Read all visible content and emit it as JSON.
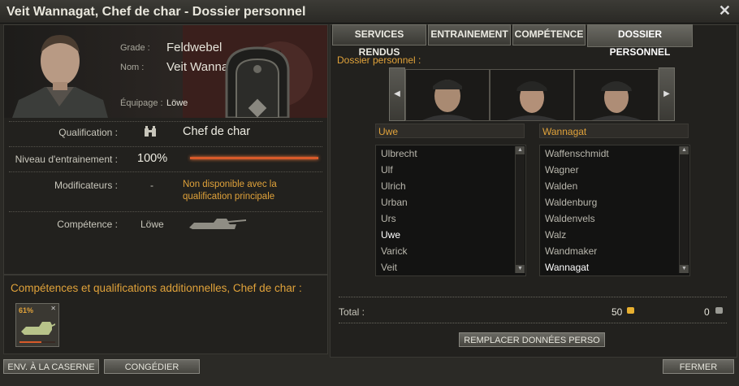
{
  "window": {
    "title": "Veit Wannagat, Chef de char - Dossier personnel",
    "close_label": "✕"
  },
  "profile": {
    "grade_label": "Grade :",
    "grade_value": "Feldwebel",
    "name_label": "Nom :",
    "name_value": "Veit Wannagat",
    "crew_label": "Équipage :",
    "crew_value": "Löwe"
  },
  "stats": {
    "qualification_label": "Qualification :",
    "qualification_value": "Chef de char",
    "training_label": "Niveau d'entrainement :",
    "training_value": "100%",
    "training_fraction": 1.0,
    "modifiers_label": "Modificateurs :",
    "modifiers_value": "-",
    "modifiers_note": "Non disponible avec la qualification principale",
    "skill_label": "Compétence :",
    "skill_value": "Löwe"
  },
  "additional": {
    "title": "Compétences et qualifications additionnelles, Chef de char :",
    "skill_percent": "61%",
    "skill_remove": "✕",
    "skill_fraction": 0.61
  },
  "tabs": [
    {
      "label": "SERVICES RENDUS"
    },
    {
      "label": "ENTRAINEMENT"
    },
    {
      "label": "COMPÉTENCE"
    },
    {
      "label": "DOSSIER PERSONNEL"
    }
  ],
  "dossier": {
    "section_label": "Dossier personnel :",
    "first_name_header": "Uwe",
    "last_name_header": "Wannagat",
    "first_names": [
      "Ulbrecht",
      "Ulf",
      "Ulrich",
      "Urban",
      "Urs",
      "Uwe",
      "Varick",
      "Veit"
    ],
    "first_selected_index": 5,
    "last_names": [
      "Waffenschmidt",
      "Wagner",
      "Walden",
      "Waldenburg",
      "Waldenvels",
      "Walz",
      "Wandmaker",
      "Wannagat"
    ],
    "last_selected_index": 7,
    "total_label": "Total :",
    "gold_cost": "50",
    "silver_cost": "0",
    "replace_button": "REMPLACER DONNÉES PERSO"
  },
  "footer": {
    "barracks_button": "ENV. À LA CASERNE",
    "dismiss_button": "CONGÉDIER",
    "close_button": "FERMER"
  },
  "colors": {
    "accent": "#e0a23a",
    "training_bar": "#d85a2a"
  }
}
